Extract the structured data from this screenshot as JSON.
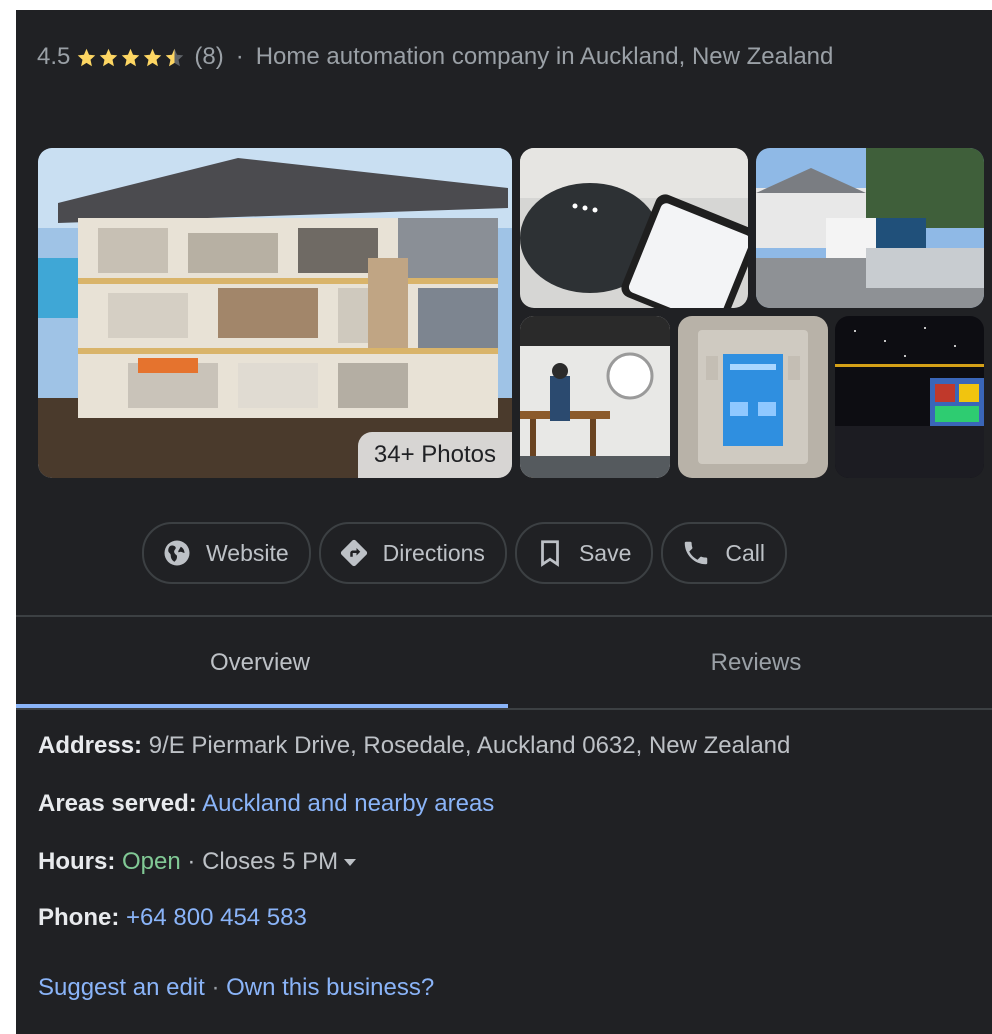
{
  "header": {
    "rating": "4.5",
    "review_count": "(8)",
    "separator": "·",
    "category": "Home automation company in Auckland, New Zealand",
    "star_color": "#fdd663"
  },
  "photos": {
    "count_label": "34+ Photos"
  },
  "actions": [
    {
      "label": "Website",
      "icon": "globe-icon"
    },
    {
      "label": "Directions",
      "icon": "directions-icon"
    },
    {
      "label": "Save",
      "icon": "bookmark-icon"
    },
    {
      "label": "Call",
      "icon": "phone-icon"
    }
  ],
  "tabs": [
    {
      "label": "Overview",
      "active": true
    },
    {
      "label": "Reviews",
      "active": false
    }
  ],
  "info": {
    "address_label": "Address:",
    "address_value": "9/E Piermark Drive, Rosedale, Auckland 0632, New Zealand",
    "areas_label": "Areas served:",
    "areas_value": "Auckland and nearby areas",
    "hours_label": "Hours:",
    "hours_status": "Open",
    "hours_sep": " · ",
    "hours_closes": "Closes 5 PM",
    "phone_label": "Phone:",
    "phone_value": "+64 800 454 583"
  },
  "footer": {
    "suggest_edit": "Suggest an edit",
    "separator": " · ",
    "own_business": "Own this business?"
  },
  "colors": {
    "background": "#202124",
    "link": "#8ab4f8",
    "open": "#81c995",
    "accent_tab": "#8ab4f8"
  }
}
